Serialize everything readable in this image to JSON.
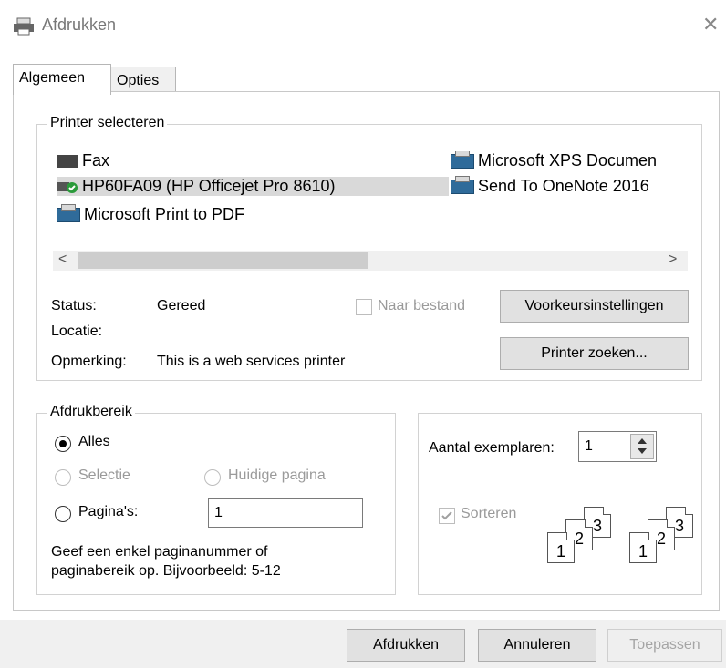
{
  "window": {
    "title": "Afdrukken",
    "close_glyph": "✕"
  },
  "tabs": [
    {
      "label": "Algemeen"
    },
    {
      "label": "Opties"
    }
  ],
  "printer_group": {
    "legend": "Printer selecteren",
    "printers": [
      {
        "name": "Fax",
        "icon": "fax-icon"
      },
      {
        "name": "HP60FA09 (HP Officejet Pro 8610)",
        "icon": "printer-default-icon"
      },
      {
        "name": "Microsoft Print to PDF",
        "icon": "printer-icon"
      },
      {
        "name": "Microsoft XPS Documen",
        "icon": "printer-icon"
      },
      {
        "name": "Send To OneNote 2016",
        "icon": "printer-icon"
      }
    ],
    "selected": "HP60FA09 (HP Officejet Pro 8610)",
    "scroll_left": "<",
    "scroll_right": ">",
    "status_label": "Status:",
    "status_value": "Gereed",
    "location_label": "Locatie:",
    "location_value": "",
    "comment_label": "Opmerking:",
    "comment_value": "This is a web services printer",
    "to_file_label": "Naar bestand",
    "prefs_button": "Voorkeursinstellingen",
    "find_button": "Printer zoeken..."
  },
  "range_group": {
    "legend": "Afdrukbereik",
    "all": "Alles",
    "selection": "Selectie",
    "current": "Huidige pagina",
    "pages": "Pagina's:",
    "pages_value": "1",
    "hint_line1": "Geef een enkel paginanummer of",
    "hint_line2": "paginabereik op. Bijvoorbeeld: 5-12"
  },
  "copies_group": {
    "copies_label": "Aantal exemplaren:",
    "copies_value": "1",
    "collate_label": "Sorteren",
    "page_numbers": [
      "1",
      "2",
      "3"
    ]
  },
  "footer": {
    "print": "Afdrukken",
    "cancel": "Annuleren",
    "apply": "Toepassen"
  },
  "colors": {
    "selected_row": "#d9d9d9",
    "disabled_text": "#a5a5a5",
    "accent": "#2f6b9a"
  }
}
